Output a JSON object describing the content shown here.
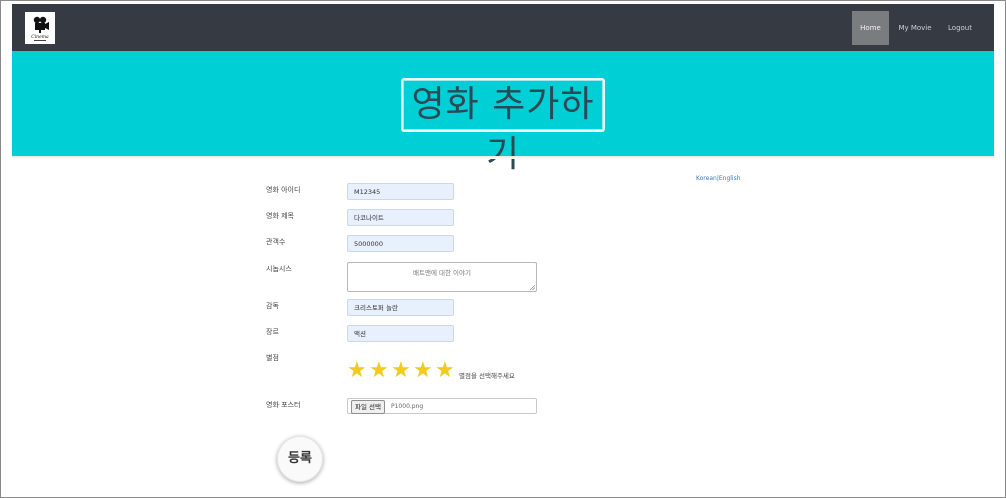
{
  "nav": {
    "logo_text": "Cinema",
    "items": [
      "Home",
      "My Movie",
      "Logout"
    ],
    "active": "Home"
  },
  "hero": {
    "title": "영화 추가하기"
  },
  "lang": {
    "korean": "Korean",
    "separator": "|",
    "english": "English"
  },
  "form": {
    "movie_id": {
      "label": "영화 아이디",
      "value": "M12345"
    },
    "movie_title": {
      "label": "영화 제목",
      "value": "다코나이트"
    },
    "audience": {
      "label": "관객수",
      "value": "5000000"
    },
    "synopsis": {
      "label": "시놉시스",
      "placeholder": "배트맨에 대한 이야기"
    },
    "director": {
      "label": "감독",
      "value": "크리스토퍼 놀란"
    },
    "genre": {
      "label": "장르",
      "value": "액션"
    },
    "rating": {
      "label": "별점",
      "stars": 5,
      "hint": "별점을 선택해주세요"
    },
    "poster": {
      "label": "영화 포스터",
      "button": "파일 선택",
      "filename": "P1000.png"
    },
    "submit": "등록"
  },
  "colors": {
    "navbar": "#353a43",
    "hero": "#00cfd6",
    "star": "#f2cb1d",
    "field_bg": "#e8f0fe"
  }
}
